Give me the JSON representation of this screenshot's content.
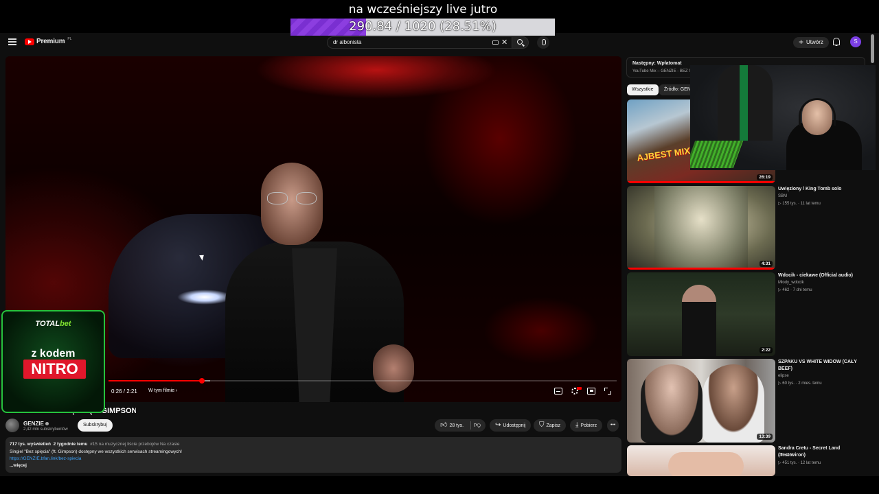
{
  "overlay": {
    "title": "na wcześniejszy live jutro",
    "goal_text": "290.84 / 1020 (28.51%)",
    "goal_progress": 0.2851
  },
  "header": {
    "logo_text": "Premium",
    "logo_region": "PL",
    "search_value": "dr albonista",
    "create_label": "Utwórz",
    "avatar_letter": "S"
  },
  "player": {
    "time": "0:26 / 2:21",
    "chapter_label": "W tym filmie",
    "played_fraction": 0.184,
    "buffered_fraction": 0.2
  },
  "sponsor": {
    "brand_a": "TOTAL",
    "brand_b": "bet",
    "line1": "z kodem",
    "code": "NITRO"
  },
  "video": {
    "title": "GENZIE - BEZ SPIĘCIA (ft. GIMPSON)",
    "channel": "GENZIE",
    "subscribers": "2,42 mln subskrybentów",
    "subscribe_label": "Subskrybuj",
    "likes": "28 tys.",
    "share_label": "Udostępnij",
    "save_label": "Zapisz",
    "download_label": "Pobierz",
    "description": {
      "views": "717 tys. wyświetleń",
      "age": "2 tygodnie temu",
      "rank": "#15 na muzycznej liście przebojów Na czasie",
      "line": "Singiel \"Bez spięcia\" (ft. Gimpson) dostępny we wszystkich serwisach streamingowych!",
      "link": "https://GENZIE.bfan.link/bez-spiecia",
      "more": "...więcej"
    }
  },
  "sidebar": {
    "next_label": "Następny: Wpłatomat",
    "mix_subtitle": "YouTube Mix – GENZIE - BEZ SPIĘCIA",
    "chip_all": "Wszystkie",
    "chip_source": "Źródło: GENZIE",
    "recommendations": [
      {
        "title": "",
        "channel": "",
        "views": "",
        "duration": "26:19",
        "progress": 1.0,
        "thumb_text": "AJBEST MIXTAPE"
      },
      {
        "title": "Uwięziony / King Tomb solo",
        "channel": "SBM",
        "views": "▷ 155 tys. · 11 lat temu",
        "duration": "4:31",
        "progress": 1.0
      },
      {
        "title": "Wdocik - ciekawe (Official audio)",
        "channel": "Młody_wdocik",
        "views": "▷ 462 · 7 dni temu",
        "duration": "2:22",
        "progress": 0
      },
      {
        "title": "SZPAKU VS WHITE WIDOW (CAŁY BEEF)",
        "channel": "elipse",
        "views": "▷ 60 tys. · 2 mies. temu",
        "duration": "13:39",
        "progress": 0
      },
      {
        "title": "Sandra Cretu - Secret Land (Testoviron)",
        "channel": "sddd888",
        "views": "▷ 451 tys. · 12 lat temu",
        "duration": "",
        "progress": 0
      }
    ]
  }
}
